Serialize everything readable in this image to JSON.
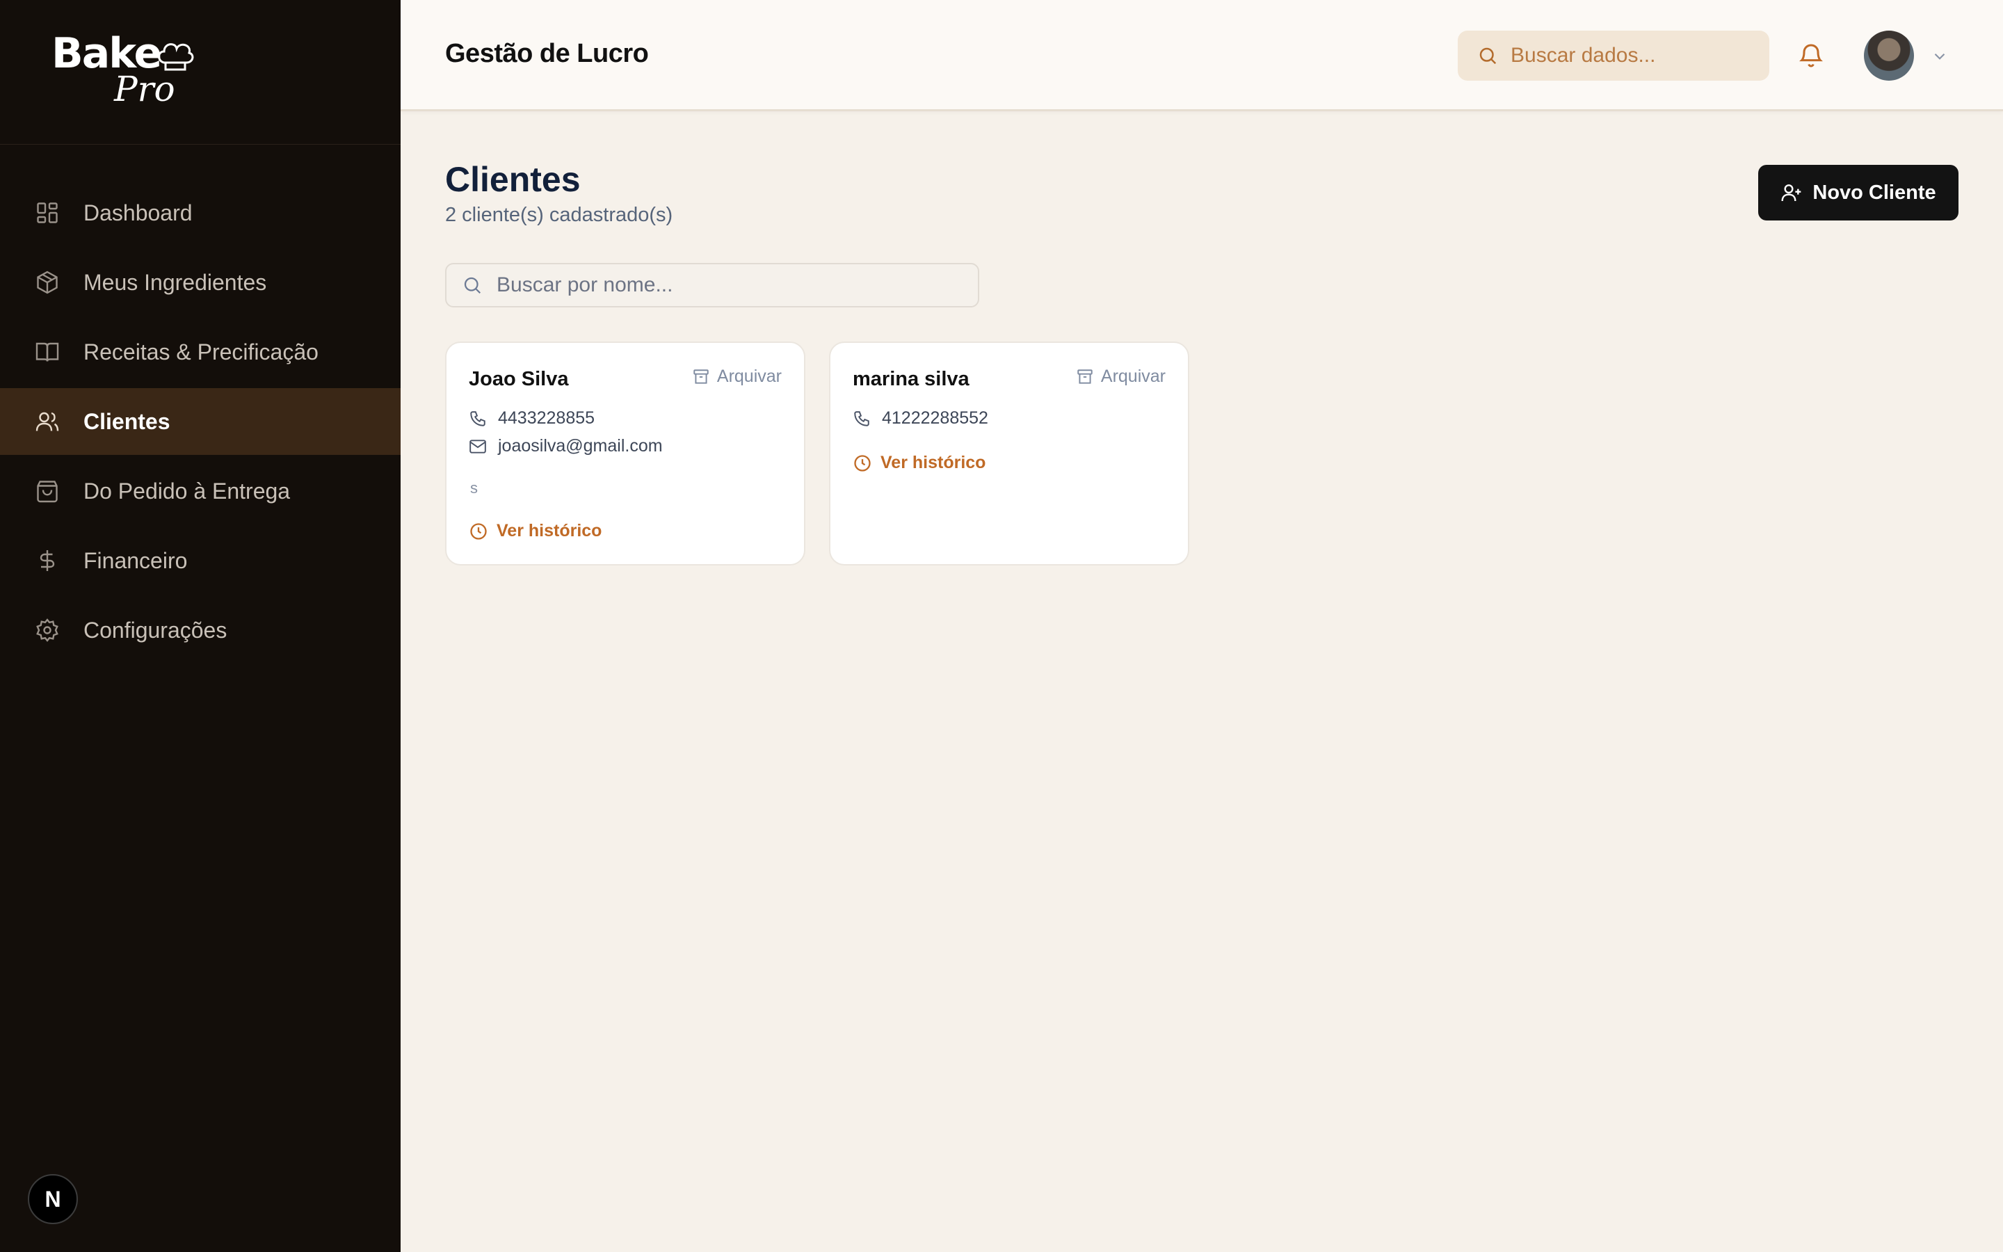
{
  "brand": {
    "name_main": "Bake",
    "name_script": "Pro"
  },
  "sidebar": {
    "items": [
      {
        "label": "Dashboard",
        "icon": "grid-icon"
      },
      {
        "label": "Meus Ingredientes",
        "icon": "box-icon"
      },
      {
        "label": "Receitas & Precificação",
        "icon": "book-icon"
      },
      {
        "label": "Clientes",
        "icon": "users-icon",
        "active": true
      },
      {
        "label": "Do Pedido à Entrega",
        "icon": "bag-icon"
      },
      {
        "label": "Financeiro",
        "icon": "dollar-icon"
      },
      {
        "label": "Configurações",
        "icon": "gear-icon"
      }
    ],
    "badge": "N"
  },
  "header": {
    "title": "Gestão de Lucro",
    "search_placeholder": "Buscar dados..."
  },
  "page": {
    "title": "Clientes",
    "subtitle": "2 cliente(s) cadastrado(s)",
    "new_button": "Novo Cliente",
    "filter_placeholder": "Buscar por nome..."
  },
  "clients": [
    {
      "name": "Joao Silva",
      "archive": "Arquivar",
      "phone": "4433228855",
      "email": "joaosilva@gmail.com",
      "note": "s",
      "history": "Ver histórico"
    },
    {
      "name": "marina silva",
      "archive": "Arquivar",
      "phone": "41222288552",
      "history": "Ver histórico"
    }
  ],
  "colors": {
    "sidebar_bg": "#130e0a",
    "active_item_bg": "#3a2716",
    "accent_orange": "#c06a26",
    "page_bg": "#f6f1ea"
  }
}
